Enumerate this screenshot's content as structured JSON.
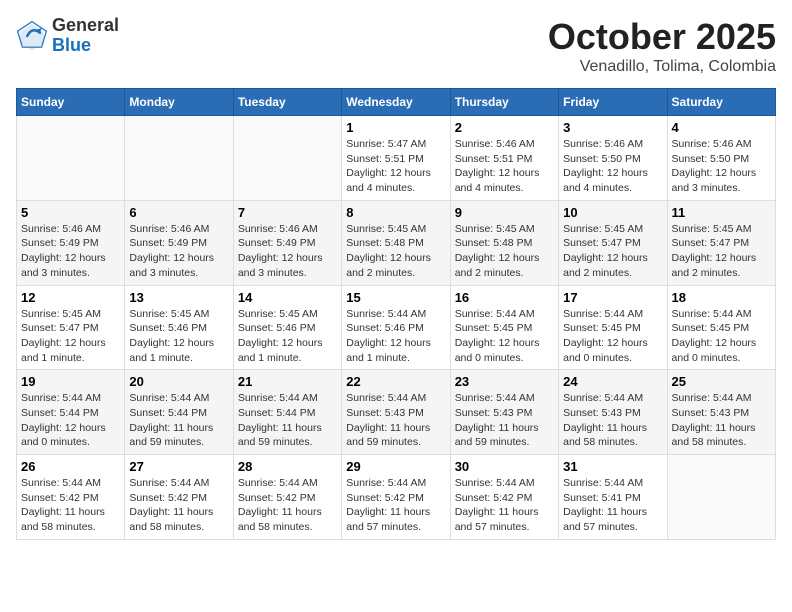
{
  "header": {
    "logo_general": "General",
    "logo_blue": "Blue",
    "month_title": "October 2025",
    "subtitle": "Venadillo, Tolima, Colombia"
  },
  "weekdays": [
    "Sunday",
    "Monday",
    "Tuesday",
    "Wednesday",
    "Thursday",
    "Friday",
    "Saturday"
  ],
  "weeks": [
    [
      {
        "day": "",
        "info": ""
      },
      {
        "day": "",
        "info": ""
      },
      {
        "day": "",
        "info": ""
      },
      {
        "day": "1",
        "info": "Sunrise: 5:47 AM\nSunset: 5:51 PM\nDaylight: 12 hours and 4 minutes."
      },
      {
        "day": "2",
        "info": "Sunrise: 5:46 AM\nSunset: 5:51 PM\nDaylight: 12 hours and 4 minutes."
      },
      {
        "day": "3",
        "info": "Sunrise: 5:46 AM\nSunset: 5:50 PM\nDaylight: 12 hours and 4 minutes."
      },
      {
        "day": "4",
        "info": "Sunrise: 5:46 AM\nSunset: 5:50 PM\nDaylight: 12 hours and 3 minutes."
      }
    ],
    [
      {
        "day": "5",
        "info": "Sunrise: 5:46 AM\nSunset: 5:49 PM\nDaylight: 12 hours and 3 minutes."
      },
      {
        "day": "6",
        "info": "Sunrise: 5:46 AM\nSunset: 5:49 PM\nDaylight: 12 hours and 3 minutes."
      },
      {
        "day": "7",
        "info": "Sunrise: 5:46 AM\nSunset: 5:49 PM\nDaylight: 12 hours and 3 minutes."
      },
      {
        "day": "8",
        "info": "Sunrise: 5:45 AM\nSunset: 5:48 PM\nDaylight: 12 hours and 2 minutes."
      },
      {
        "day": "9",
        "info": "Sunrise: 5:45 AM\nSunset: 5:48 PM\nDaylight: 12 hours and 2 minutes."
      },
      {
        "day": "10",
        "info": "Sunrise: 5:45 AM\nSunset: 5:47 PM\nDaylight: 12 hours and 2 minutes."
      },
      {
        "day": "11",
        "info": "Sunrise: 5:45 AM\nSunset: 5:47 PM\nDaylight: 12 hours and 2 minutes."
      }
    ],
    [
      {
        "day": "12",
        "info": "Sunrise: 5:45 AM\nSunset: 5:47 PM\nDaylight: 12 hours and 1 minute."
      },
      {
        "day": "13",
        "info": "Sunrise: 5:45 AM\nSunset: 5:46 PM\nDaylight: 12 hours and 1 minute."
      },
      {
        "day": "14",
        "info": "Sunrise: 5:45 AM\nSunset: 5:46 PM\nDaylight: 12 hours and 1 minute."
      },
      {
        "day": "15",
        "info": "Sunrise: 5:44 AM\nSunset: 5:46 PM\nDaylight: 12 hours and 1 minute."
      },
      {
        "day": "16",
        "info": "Sunrise: 5:44 AM\nSunset: 5:45 PM\nDaylight: 12 hours and 0 minutes."
      },
      {
        "day": "17",
        "info": "Sunrise: 5:44 AM\nSunset: 5:45 PM\nDaylight: 12 hours and 0 minutes."
      },
      {
        "day": "18",
        "info": "Sunrise: 5:44 AM\nSunset: 5:45 PM\nDaylight: 12 hours and 0 minutes."
      }
    ],
    [
      {
        "day": "19",
        "info": "Sunrise: 5:44 AM\nSunset: 5:44 PM\nDaylight: 12 hours and 0 minutes."
      },
      {
        "day": "20",
        "info": "Sunrise: 5:44 AM\nSunset: 5:44 PM\nDaylight: 11 hours and 59 minutes."
      },
      {
        "day": "21",
        "info": "Sunrise: 5:44 AM\nSunset: 5:44 PM\nDaylight: 11 hours and 59 minutes."
      },
      {
        "day": "22",
        "info": "Sunrise: 5:44 AM\nSunset: 5:43 PM\nDaylight: 11 hours and 59 minutes."
      },
      {
        "day": "23",
        "info": "Sunrise: 5:44 AM\nSunset: 5:43 PM\nDaylight: 11 hours and 59 minutes."
      },
      {
        "day": "24",
        "info": "Sunrise: 5:44 AM\nSunset: 5:43 PM\nDaylight: 11 hours and 58 minutes."
      },
      {
        "day": "25",
        "info": "Sunrise: 5:44 AM\nSunset: 5:43 PM\nDaylight: 11 hours and 58 minutes."
      }
    ],
    [
      {
        "day": "26",
        "info": "Sunrise: 5:44 AM\nSunset: 5:42 PM\nDaylight: 11 hours and 58 minutes."
      },
      {
        "day": "27",
        "info": "Sunrise: 5:44 AM\nSunset: 5:42 PM\nDaylight: 11 hours and 58 minutes."
      },
      {
        "day": "28",
        "info": "Sunrise: 5:44 AM\nSunset: 5:42 PM\nDaylight: 11 hours and 58 minutes."
      },
      {
        "day": "29",
        "info": "Sunrise: 5:44 AM\nSunset: 5:42 PM\nDaylight: 11 hours and 57 minutes."
      },
      {
        "day": "30",
        "info": "Sunrise: 5:44 AM\nSunset: 5:42 PM\nDaylight: 11 hours and 57 minutes."
      },
      {
        "day": "31",
        "info": "Sunrise: 5:44 AM\nSunset: 5:41 PM\nDaylight: 11 hours and 57 minutes."
      },
      {
        "day": "",
        "info": ""
      }
    ]
  ]
}
